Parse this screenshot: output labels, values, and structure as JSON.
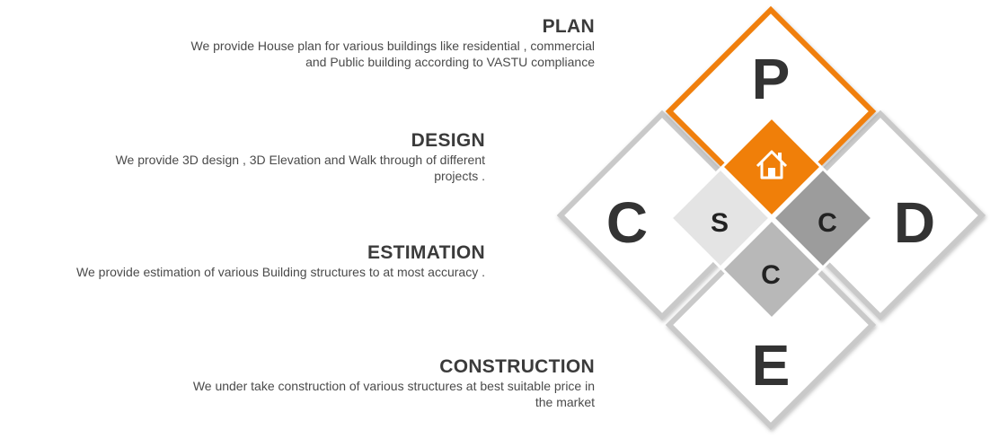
{
  "services": {
    "plan": {
      "title": "PLAN",
      "line1": "We provide House plan for various buildings like residential , commercial",
      "line2": "and Public building according to VASTU compliance"
    },
    "design": {
      "title": "DESIGN",
      "line1": "We provide 3D design , 3D Elevation and Walk through  of different",
      "line2": "projects ."
    },
    "estimation": {
      "title": "ESTIMATION",
      "line1": "We provide estimation of various Building structures to  at most accuracy ."
    },
    "construction": {
      "title": "CONSTRUCTION",
      "line1": "We under take construction  of various structures  at best suitable price in",
      "line2": "the market"
    }
  },
  "diagram": {
    "outer_letters": {
      "top": "P",
      "right": "D",
      "bottom": "E",
      "left": "C"
    },
    "inner_letters": {
      "left": "S",
      "right": "C",
      "bottom": "C"
    },
    "center_icon": "home-icon",
    "colors": {
      "accent": "#f07f09",
      "outline_gray": "#c9c9c9",
      "inner_left": "#e4e4e4",
      "inner_right": "#9c9c9c",
      "inner_bottom": "#b8b8b8",
      "text_dark": "#333333"
    }
  }
}
